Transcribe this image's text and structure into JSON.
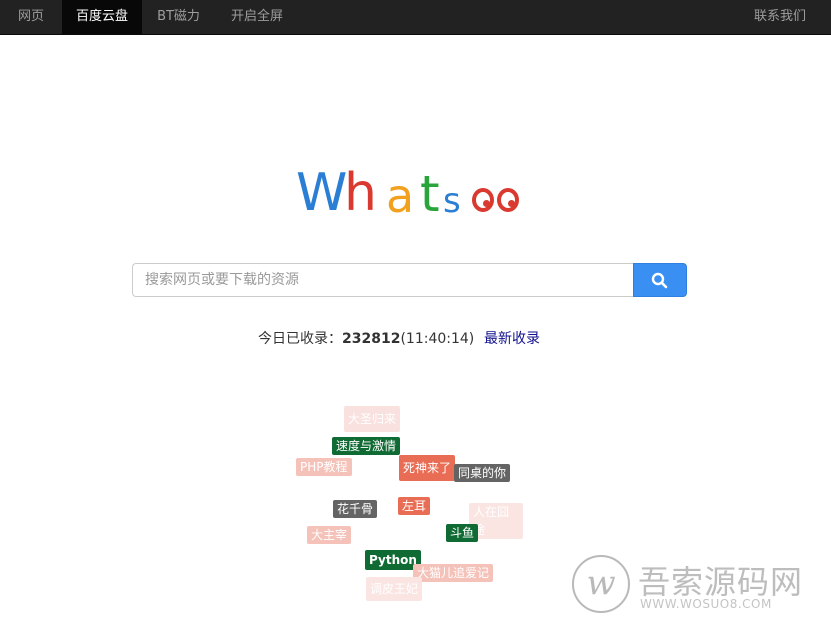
{
  "nav": {
    "items": [
      {
        "label": "网页",
        "active": false
      },
      {
        "label": "百度云盘",
        "active": true
      },
      {
        "label": "BT磁力",
        "active": false
      },
      {
        "label": "开启全屏",
        "active": false
      }
    ],
    "contact": "联系我们"
  },
  "logo": {
    "letters": [
      "W",
      "h",
      "a",
      "t",
      "s"
    ],
    "colors": [
      "#2a7fd4",
      "#d9392e",
      "#f1a11e",
      "#2aa53b",
      "#2a7fd4",
      "#d9392e"
    ]
  },
  "search": {
    "placeholder": "搜索网页或要下载的资源",
    "value": "",
    "button_icon": "search-icon",
    "button_color": "#3a8ff3"
  },
  "stats": {
    "prefix": "今日已收录：",
    "count": "232812",
    "time": "(11:40:14)",
    "latest_link": "最新收录"
  },
  "tags": [
    {
      "label": "大圣归来",
      "bg": "#f8e1de",
      "color": "#ffffff"
    },
    {
      "label": "速度与激情",
      "bg": "#0f6a33",
      "color": "#ffffff"
    },
    {
      "label": "PHP教程",
      "bg": "#f4c2b9",
      "color": "#ffffff"
    },
    {
      "label": "死神来了",
      "bg": "#e96d54",
      "color": "#ffffff"
    },
    {
      "label": "同桌的你",
      "bg": "#646464",
      "color": "#ffffff"
    },
    {
      "label": "花千骨",
      "bg": "#646464",
      "color": "#ffffff"
    },
    {
      "label": "左耳",
      "bg": "#e96d54",
      "color": "#ffffff"
    },
    {
      "label": "人在囧途",
      "bg": "#fae5e2",
      "color": "#ffffff"
    },
    {
      "label": "大主宰",
      "bg": "#f4c2b9",
      "color": "#ffffff"
    },
    {
      "label": "斗鱼",
      "bg": "#0f6a33",
      "color": "#ffffff"
    },
    {
      "label": "Python",
      "bg": "#0f6a33",
      "color": "#ffffff"
    },
    {
      "label": "大猫儿追爱记",
      "bg": "#f4c2b9",
      "color": "#ffffff"
    },
    {
      "label": "调皮王妃",
      "bg": "#fae5e2",
      "color": "#ffffff"
    }
  ],
  "watermark": {
    "brand": "吾索源码网",
    "url": "WWW.WOSUO8.COM"
  }
}
